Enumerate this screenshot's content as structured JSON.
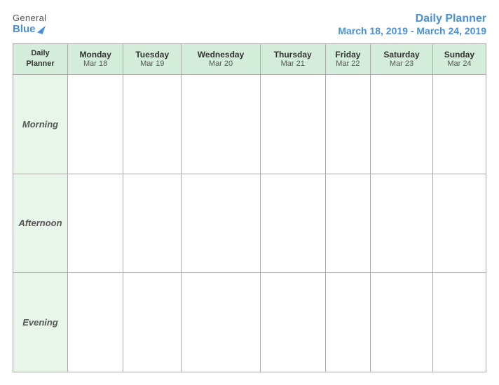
{
  "logo": {
    "general": "General",
    "blue": "Blue",
    "triangle": "▶"
  },
  "title": {
    "main": "Daily Planner",
    "sub": "March 18, 2019 - March 24, 2019"
  },
  "table": {
    "label_top": "Daily",
    "label_bottom": "Planner",
    "days": [
      {
        "name": "Monday",
        "date": "Mar 18"
      },
      {
        "name": "Tuesday",
        "date": "Mar 19"
      },
      {
        "name": "Wednesday",
        "date": "Mar 20"
      },
      {
        "name": "Thursday",
        "date": "Mar 21"
      },
      {
        "name": "Friday",
        "date": "Mar 22"
      },
      {
        "name": "Saturday",
        "date": "Mar 23"
      },
      {
        "name": "Sunday",
        "date": "Mar 24"
      }
    ],
    "time_slots": [
      "Morning",
      "Afternoon",
      "Evening"
    ]
  }
}
